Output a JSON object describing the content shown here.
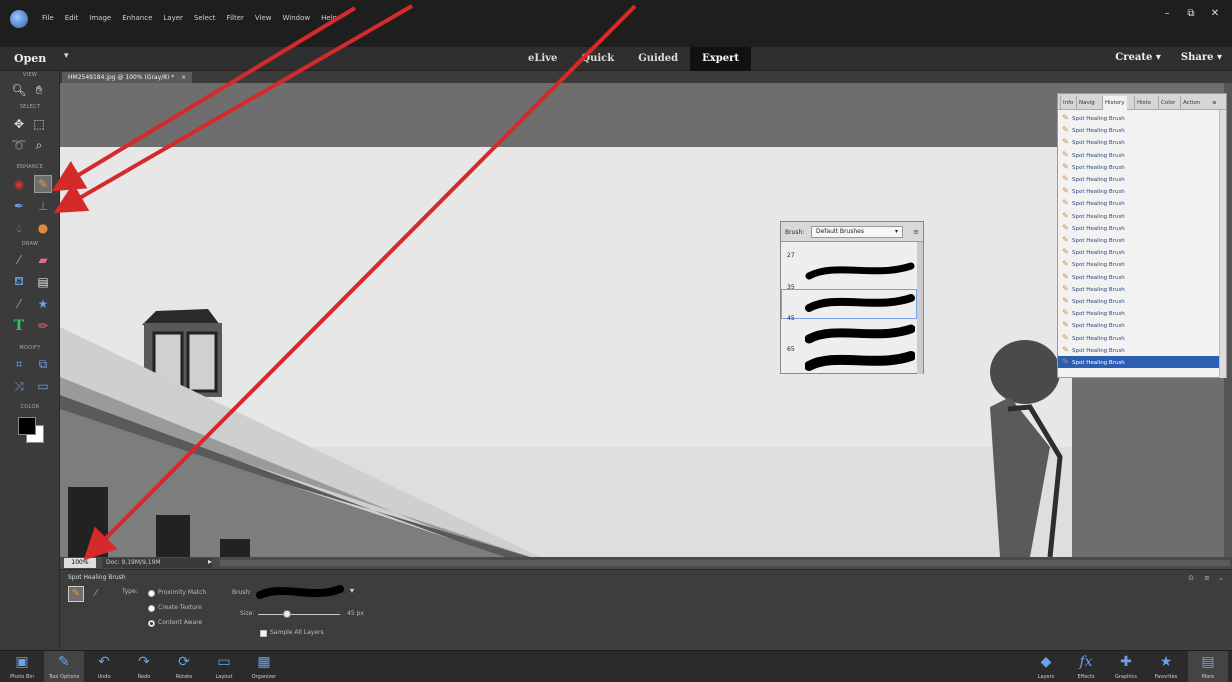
{
  "menubar": {
    "items": [
      "File",
      "Edit",
      "Image",
      "Enhance",
      "Layer",
      "Select",
      "Filter",
      "View",
      "Window",
      "Help"
    ],
    "window_controls": [
      "–",
      "⧉",
      "✕"
    ]
  },
  "modebar": {
    "open_label": "Open",
    "modes": [
      "eLive",
      "Quick",
      "Guided",
      "Expert"
    ],
    "active_mode": "Expert",
    "create_label": "Create",
    "share_label": "Share"
  },
  "toolbox": {
    "sections": [
      "VIEW",
      "SELECT",
      "ENHANCE",
      "DRAW",
      "MODIFY",
      "COLOR"
    ]
  },
  "document": {
    "tab_label": "HM2549184.jpg @ 100% (Gray/8) *",
    "zoom": "100%",
    "doc_size": "Doc: 9,19M/9,19M"
  },
  "history_panel": {
    "tabs": [
      "Info",
      "Navig",
      "History",
      "Histo",
      "Color",
      "Action"
    ],
    "active_tab": "History",
    "items": [
      "Spot Healing Brush",
      "Spot Healing Brush",
      "Spot Healing Brush",
      "Spot Healing Brush",
      "Spot Healing Brush",
      "Spot Healing Brush",
      "Spot Healing Brush",
      "Spot Healing Brush",
      "Spot Healing Brush",
      "Spot Healing Brush",
      "Spot Healing Brush",
      "Spot Healing Brush",
      "Spot Healing Brush",
      "Spot Healing Brush",
      "Spot Healing Brush",
      "Spot Healing Brush",
      "Spot Healing Brush",
      "Spot Healing Brush",
      "Spot Healing Brush",
      "Spot Healing Brush",
      "Spot Healing Brush"
    ],
    "selected_index": 20
  },
  "brush_picker": {
    "label": "Brush:",
    "selected": "Default Brushes",
    "sizes": [
      "27",
      "35",
      "45",
      "65"
    ]
  },
  "tool_options": {
    "title": "Spot Healing Brush",
    "type_label": "Type:",
    "types": [
      "Proximity Match",
      "Create Texture",
      "Content Aware"
    ],
    "selected_type": "Content Aware",
    "brush_label": "Brush:",
    "size_label": "Size:",
    "size_value": "45 px",
    "size_fraction": 0.35,
    "sample_all_layers": "Sample All Layers"
  },
  "taskbar": {
    "left": [
      "Photo Bin",
      "Tool Options",
      "Undo",
      "Redo",
      "Rotate",
      "Layout",
      "Organizer"
    ],
    "right": [
      "Layers",
      "Effects",
      "Graphics",
      "Favorites",
      "More"
    ]
  },
  "colors": {
    "accent_blue": "#2c5fb3",
    "annotation_red": "#d42a2a"
  }
}
